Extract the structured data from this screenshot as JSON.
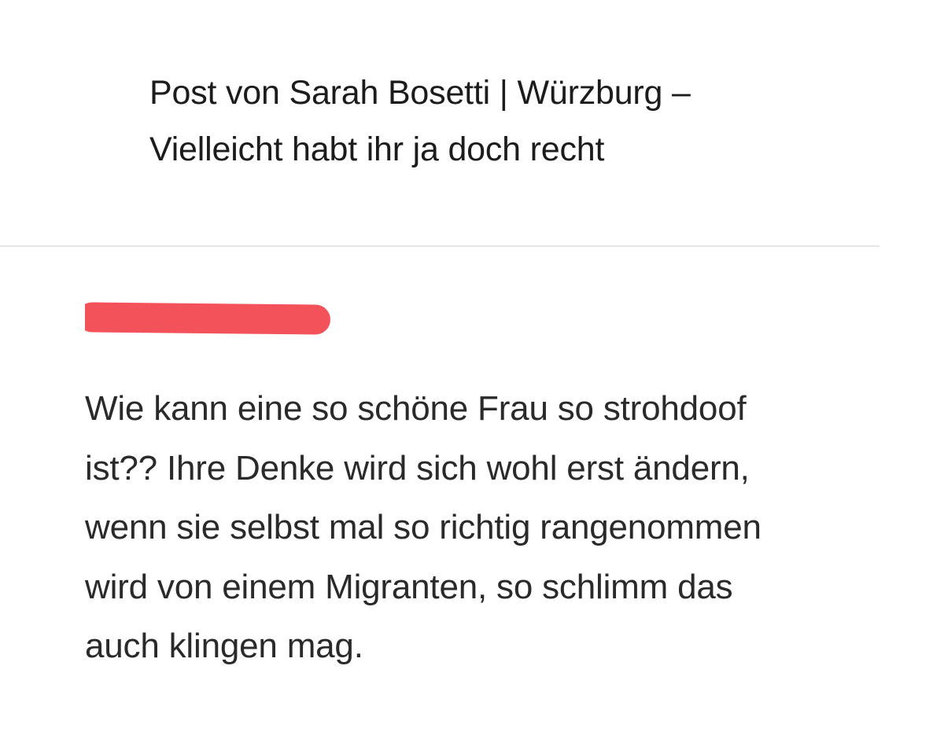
{
  "post": {
    "header_line1": "Post von Sarah Bosetti | Würzburg –",
    "header_line2": "Vielleicht habt ihr ja doch recht"
  },
  "comment": {
    "author": "",
    "lines": [
      "Wie kann eine so schöne Frau so strohdoof",
      "ist?? Ihre Denke wird sich wohl erst ändern,",
      "wenn sie selbst mal so richtig rangenommen",
      "wird von einem Migranten, so schlimm das",
      "auch klingen mag."
    ]
  },
  "colors": {
    "redaction": "#f4525a",
    "divider": "#e6e6e6"
  }
}
